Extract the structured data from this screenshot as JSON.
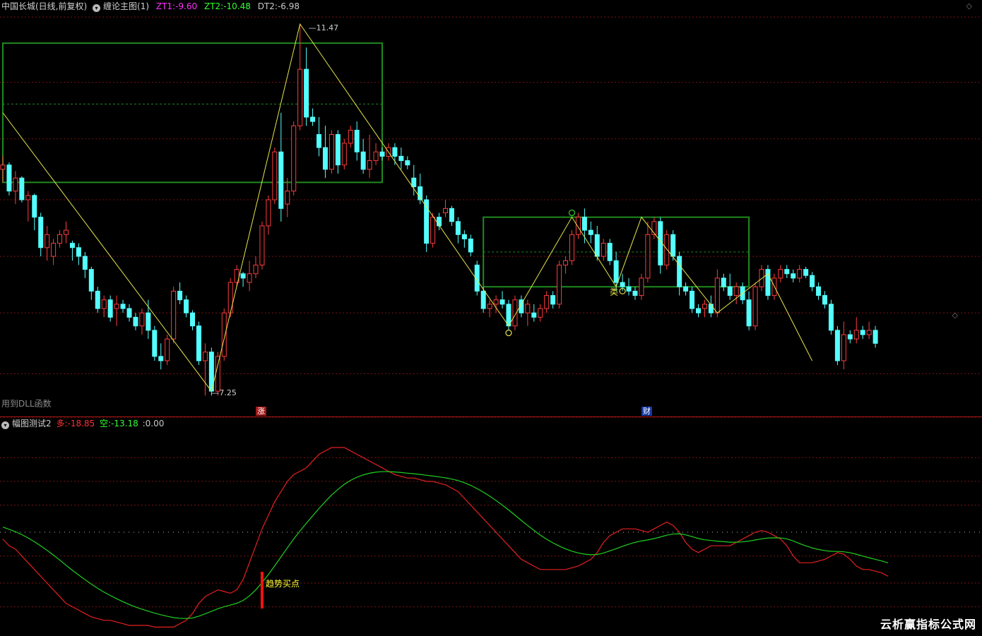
{
  "main_panel": {
    "title": "中国长城(日线,前复权)",
    "indicator_name": "缠论主图(1)",
    "params": [
      {
        "label": "ZT1:",
        "value": "-9.60",
        "color": "#ff33ff"
      },
      {
        "label": "ZT2:",
        "value": "-10.48",
        "color": "#33ff33"
      },
      {
        "label": "DT2:",
        "value": "-6.98",
        "color": "#c8c8c8"
      }
    ],
    "dll_note": "用到DLL函数",
    "price_labels": {
      "high": "11.47",
      "low": "7.25"
    },
    "badges": {
      "zhang": "涨",
      "cai": "财"
    },
    "lei_label": "类",
    "corner_icons": [
      "◇",
      "◇"
    ]
  },
  "sub_panel": {
    "title": "幅图测试2",
    "values": [
      {
        "label": "多:",
        "value": "-18.85",
        "color": "#ff3333"
      },
      {
        "label": "空:",
        "value": "-13.18",
        "color": "#33ff33"
      },
      {
        "label": ":",
        "value": "0.00",
        "color": "#c8c8c8"
      }
    ],
    "buy_label": "趋势买点"
  },
  "watermark": "云析赢指标公式网",
  "colors": {
    "up": "#ff3c3c",
    "down": "#54ffff",
    "zigzag": "#e6e64b",
    "box": "#1f8a1f",
    "grid": "#7a1010",
    "duo_line": "#e62020",
    "kong_line": "#20d020"
  },
  "chart_data": {
    "type": "candlestick",
    "price_range": [
      7.0,
      11.6
    ],
    "candles": [
      [
        9.8,
        9.95,
        9.65,
        9.85
      ],
      [
        9.85,
        9.88,
        9.5,
        9.55
      ],
      [
        9.55,
        9.78,
        9.4,
        9.7
      ],
      [
        9.7,
        9.72,
        9.42,
        9.45
      ],
      [
        9.45,
        9.55,
        9.2,
        9.5
      ],
      [
        9.5,
        9.52,
        9.1,
        9.25
      ],
      [
        9.25,
        9.3,
        8.8,
        8.9
      ],
      [
        8.9,
        9.15,
        8.75,
        9.05
      ],
      [
        8.8,
        9.0,
        8.7,
        8.95
      ],
      [
        8.95,
        9.1,
        8.9,
        9.05
      ],
      [
        9.05,
        9.2,
        8.95,
        9.1
      ],
      [
        8.95,
        8.98,
        8.75,
        8.9
      ],
      [
        8.9,
        8.95,
        8.7,
        8.8
      ],
      [
        8.8,
        8.85,
        8.55,
        8.65
      ],
      [
        8.65,
        8.68,
        8.3,
        8.4
      ],
      [
        8.4,
        8.45,
        8.15,
        8.2
      ],
      [
        8.2,
        8.35,
        8.1,
        8.3
      ],
      [
        8.3,
        8.35,
        8.05,
        8.1
      ],
      [
        8.2,
        8.35,
        8.0,
        8.25
      ],
      [
        8.25,
        8.3,
        8.15,
        8.2
      ],
      [
        8.2,
        8.25,
        8.05,
        8.1
      ],
      [
        8.1,
        8.15,
        7.95,
        8.0
      ],
      [
        8.0,
        8.2,
        7.9,
        8.15
      ],
      [
        8.15,
        8.3,
        7.85,
        7.95
      ],
      [
        7.95,
        8.0,
        7.6,
        7.65
      ],
      [
        7.65,
        7.8,
        7.5,
        7.6
      ],
      [
        7.6,
        7.9,
        7.55,
        7.85
      ],
      [
        7.85,
        8.45,
        7.8,
        8.4
      ],
      [
        8.4,
        8.5,
        8.25,
        8.3
      ],
      [
        8.3,
        8.35,
        8.1,
        8.15
      ],
      [
        8.15,
        8.18,
        7.95,
        8.0
      ],
      [
        8.0,
        8.05,
        7.55,
        7.6
      ],
      [
        7.6,
        7.8,
        7.2,
        7.7
      ],
      [
        7.7,
        7.75,
        7.2,
        7.25
      ],
      [
        7.25,
        7.7,
        7.2,
        7.65
      ],
      [
        7.65,
        8.2,
        7.6,
        8.15
      ],
      [
        8.15,
        8.55,
        8.1,
        8.5
      ],
      [
        8.5,
        8.7,
        8.45,
        8.65
      ],
      [
        8.6,
        8.62,
        8.45,
        8.55
      ],
      [
        8.5,
        8.75,
        8.4,
        8.6
      ],
      [
        8.6,
        8.8,
        8.55,
        8.7
      ],
      [
        8.7,
        9.2,
        8.65,
        9.15
      ],
      [
        9.15,
        9.5,
        9.05,
        9.45
      ],
      [
        9.45,
        10.05,
        9.4,
        10.0
      ],
      [
        10.0,
        10.45,
        9.2,
        9.35
      ],
      [
        9.4,
        9.7,
        9.25,
        9.55
      ],
      [
        9.55,
        10.35,
        9.5,
        10.3
      ],
      [
        10.3,
        11.47,
        10.25,
        10.95
      ],
      [
        10.95,
        11.2,
        10.3,
        10.4
      ],
      [
        10.4,
        10.5,
        10.3,
        10.35
      ],
      [
        10.2,
        10.4,
        9.95,
        10.05
      ],
      [
        10.05,
        10.3,
        9.7,
        9.8
      ],
      [
        9.8,
        10.25,
        9.75,
        10.2
      ],
      [
        10.2,
        10.25,
        9.75,
        9.85
      ],
      [
        9.85,
        10.15,
        9.8,
        10.1
      ],
      [
        10.1,
        10.3,
        10.05,
        10.25
      ],
      [
        10.25,
        10.35,
        9.9,
        10.0
      ],
      [
        10.0,
        10.15,
        9.75,
        9.8
      ],
      [
        9.8,
        10.2,
        9.7,
        9.9
      ],
      [
        9.9,
        10.1,
        9.85,
        10.0
      ],
      [
        10.0,
        10.05,
        9.9,
        9.95
      ],
      [
        9.95,
        10.1,
        9.9,
        10.05
      ],
      [
        10.05,
        10.1,
        9.85,
        9.95
      ],
      [
        9.95,
        10.05,
        9.8,
        9.9
      ],
      [
        9.9,
        9.95,
        9.8,
        9.85
      ],
      [
        9.7,
        9.85,
        9.5,
        9.6
      ],
      [
        9.6,
        9.75,
        9.4,
        9.45
      ],
      [
        9.45,
        9.5,
        8.85,
        8.95
      ],
      [
        8.95,
        9.3,
        8.9,
        9.25
      ],
      [
        9.25,
        9.3,
        9.1,
        9.15
      ],
      [
        9.3,
        9.45,
        9.25,
        9.35
      ],
      [
        9.35,
        9.38,
        9.15,
        9.2
      ],
      [
        9.2,
        9.25,
        8.95,
        9.05
      ],
      [
        9.05,
        9.1,
        8.9,
        9.0
      ],
      [
        9.0,
        9.05,
        8.8,
        8.85
      ],
      [
        8.7,
        8.75,
        8.35,
        8.4
      ],
      [
        8.4,
        8.45,
        8.15,
        8.2
      ],
      [
        8.2,
        8.3,
        8.1,
        8.25
      ],
      [
        8.25,
        8.35,
        8.15,
        8.3
      ],
      [
        8.3,
        8.4,
        8.2,
        8.25
      ],
      [
        8.25,
        8.3,
        7.95,
        8.0
      ],
      [
        8.0,
        8.35,
        7.95,
        8.3
      ],
      [
        8.3,
        8.35,
        8.1,
        8.15
      ],
      [
        8.15,
        8.3,
        8.0,
        8.25
      ],
      [
        8.15,
        8.25,
        8.05,
        8.1
      ],
      [
        8.1,
        8.25,
        8.05,
        8.2
      ],
      [
        8.2,
        8.4,
        8.15,
        8.35
      ],
      [
        8.35,
        8.4,
        8.2,
        8.25
      ],
      [
        8.25,
        8.75,
        8.2,
        8.7
      ],
      [
        8.7,
        8.8,
        8.6,
        8.75
      ],
      [
        8.75,
        9.1,
        8.7,
        9.05
      ],
      [
        9.05,
        9.3,
        9.0,
        9.25
      ],
      [
        9.25,
        9.35,
        8.95,
        9.1
      ],
      [
        9.1,
        9.2,
        8.95,
        9.05
      ],
      [
        9.05,
        9.15,
        8.75,
        8.8
      ],
      [
        8.8,
        9.0,
        8.75,
        8.95
      ],
      [
        8.95,
        9.0,
        8.7,
        8.75
      ],
      [
        8.75,
        8.85,
        8.4,
        8.5
      ],
      [
        8.5,
        8.6,
        8.4,
        8.45
      ],
      [
        8.45,
        8.55,
        8.35,
        8.4
      ],
      [
        8.4,
        8.45,
        8.3,
        8.35
      ],
      [
        8.35,
        8.6,
        8.3,
        8.55
      ],
      [
        8.55,
        9.2,
        8.5,
        9.05
      ],
      [
        9.05,
        9.25,
        9.0,
        9.2
      ],
      [
        9.2,
        9.25,
        8.6,
        8.7
      ],
      [
        8.7,
        9.1,
        8.65,
        9.05
      ],
      [
        9.05,
        9.1,
        8.75,
        8.8
      ],
      [
        8.8,
        8.85,
        8.35,
        8.45
      ],
      [
        8.45,
        8.5,
        8.35,
        8.4
      ],
      [
        8.4,
        8.45,
        8.15,
        8.2
      ],
      [
        8.2,
        8.25,
        8.1,
        8.15
      ],
      [
        8.2,
        8.3,
        8.1,
        8.25
      ],
      [
        8.25,
        8.35,
        8.1,
        8.15
      ],
      [
        8.15,
        8.65,
        8.1,
        8.55
      ],
      [
        8.55,
        8.6,
        8.4,
        8.45
      ],
      [
        8.45,
        8.6,
        8.3,
        8.35
      ],
      [
        8.35,
        8.5,
        8.25,
        8.45
      ],
      [
        8.45,
        8.5,
        8.25,
        8.3
      ],
      [
        8.3,
        8.4,
        7.95,
        8.0
      ],
      [
        8.0,
        8.5,
        7.95,
        8.45
      ],
      [
        8.45,
        8.7,
        8.4,
        8.65
      ],
      [
        8.65,
        8.7,
        8.3,
        8.35
      ],
      [
        8.35,
        8.6,
        8.3,
        8.55
      ],
      [
        8.55,
        8.7,
        8.5,
        8.65
      ],
      [
        8.65,
        8.7,
        8.55,
        8.6
      ],
      [
        8.6,
        8.65,
        8.5,
        8.55
      ],
      [
        8.55,
        8.7,
        8.5,
        8.65
      ],
      [
        8.65,
        8.68,
        8.55,
        8.58
      ],
      [
        8.58,
        8.62,
        8.4,
        8.45
      ],
      [
        8.45,
        8.5,
        8.3,
        8.35
      ],
      [
        8.35,
        8.4,
        8.2,
        8.25
      ],
      [
        8.25,
        8.3,
        7.9,
        7.95
      ],
      [
        7.95,
        8.0,
        7.55,
        7.6
      ],
      [
        7.6,
        8.05,
        7.5,
        7.9
      ],
      [
        7.9,
        7.95,
        7.8,
        7.85
      ],
      [
        7.85,
        8.1,
        7.8,
        7.95
      ],
      [
        7.95,
        8.0,
        7.85,
        7.9
      ],
      [
        7.9,
        8.05,
        7.85,
        7.95
      ],
      [
        7.95,
        8.0,
        7.75,
        7.8
      ]
    ],
    "zigzag": [
      {
        "i": 0,
        "p": 10.45
      },
      {
        "i": 33,
        "p": 7.25
      },
      {
        "i": 47,
        "p": 11.47
      },
      {
        "i": 80,
        "p": 8.0
      },
      {
        "i": 90,
        "p": 9.25
      },
      {
        "i": 97,
        "p": 8.45
      },
      {
        "i": 101,
        "p": 9.25
      },
      {
        "i": 113,
        "p": 8.15
      },
      {
        "i": 121,
        "p": 8.6
      },
      {
        "i": 128,
        "p": 7.6
      }
    ],
    "pivot_boxes": [
      {
        "i0": 0,
        "i1": 60,
        "top": 11.25,
        "bottom": 9.65,
        "mid": 10.55
      },
      {
        "i0": 76,
        "i1": 118,
        "top": 9.25,
        "bottom": 8.45,
        "mid": 8.85
      }
    ],
    "price_grid": [
      11.55,
      10.8,
      10.15,
      9.45,
      8.8,
      8.15,
      7.45,
      6.95
    ],
    "sub_range": [
      -30,
      30
    ],
    "sub_grid": [
      22,
      15,
      8,
      0,
      -7,
      -15,
      -22
    ],
    "duo_series": [
      -2,
      -4,
      -5,
      -7,
      -9,
      -11,
      -13,
      -15,
      -17,
      -19,
      -21,
      -22,
      -23,
      -24,
      -25,
      -25.5,
      -26,
      -26,
      -26.5,
      -27,
      -27.5,
      -27.5,
      -27.5,
      -27.5,
      -28,
      -28,
      -28,
      -28,
      -27,
      -26,
      -24,
      -21,
      -19,
      -18,
      -17,
      -17.5,
      -18,
      -17,
      -14,
      -9,
      -4,
      1,
      5,
      9,
      12,
      15,
      17,
      18,
      19,
      21,
      23,
      24,
      25,
      25,
      25,
      24,
      23,
      22,
      21,
      20,
      19,
      18,
      17,
      16.5,
      16,
      16,
      15.5,
      15,
      15,
      14.5,
      14,
      13,
      12,
      10,
      8,
      6,
      4,
      2,
      0,
      -2,
      -4,
      -6,
      -8,
      -9,
      -10,
      -11,
      -11,
      -11,
      -11,
      -11,
      -10.5,
      -10,
      -9,
      -8,
      -6,
      -3,
      -1,
      0,
      1,
      1,
      1,
      0.5,
      0,
      1,
      2,
      3,
      2,
      0,
      -3,
      -5,
      -6,
      -5,
      -4,
      -4,
      -4,
      -4,
      -3,
      -2,
      -1,
      0,
      0.5,
      0,
      -1,
      -2,
      -4,
      -7,
      -9,
      -9,
      -9,
      -8.5,
      -8,
      -7,
      -6,
      -6.5,
      -8,
      -10,
      -11,
      -11,
      -11.5,
      -12,
      -13
    ]
  }
}
